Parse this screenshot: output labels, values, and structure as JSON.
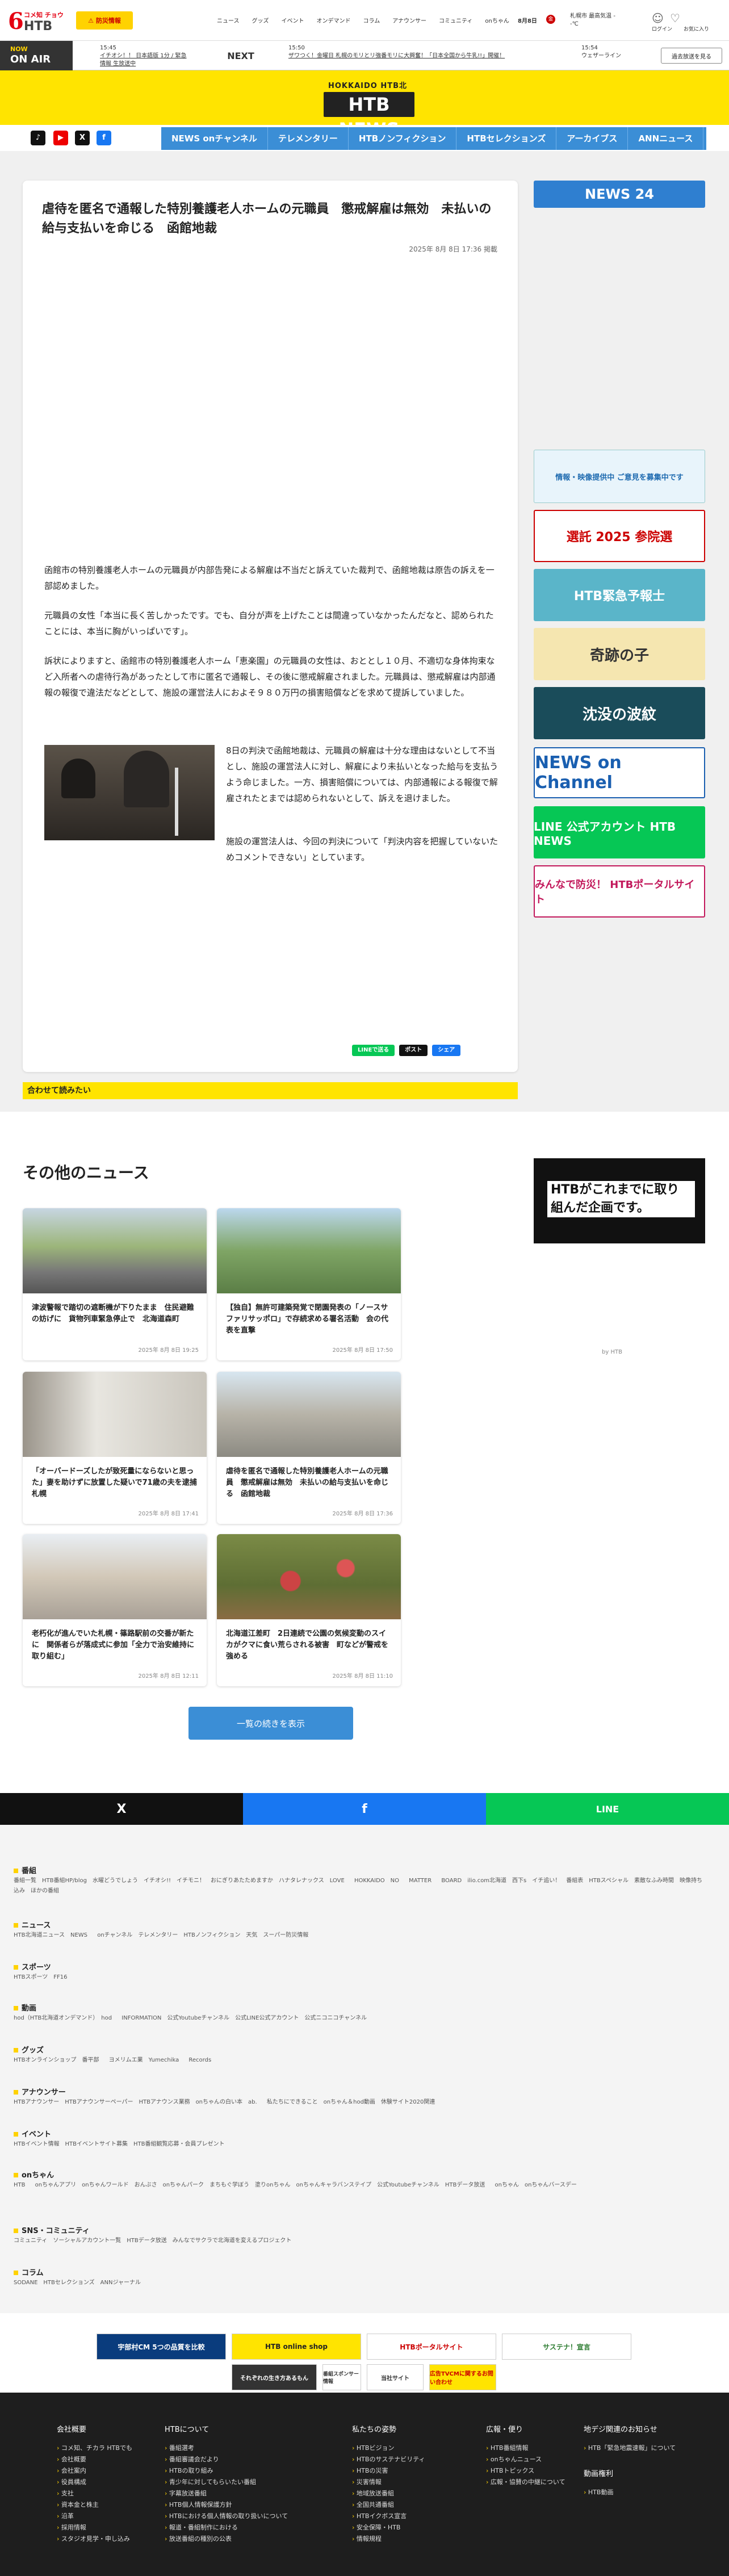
{
  "header": {
    "logo_small": "コメ知 チョウ",
    "logo_htb": "HTB",
    "disaster_button": "防災情報",
    "nav": [
      "ニュース",
      "グッズ",
      "イベント",
      "オンデマンド",
      "コラム",
      "アナウンサー",
      "コミュニティ",
      "onちゃん"
    ],
    "weather_date": "8月8日",
    "weather_badge": "金",
    "weather_place": "札幌市 最高気温 --℃",
    "account_links": [
      "ログイン",
      "お気に入り"
    ]
  },
  "onair": {
    "now_label": "NOW",
    "now_sub": "ON AIR",
    "now_time": "15:45",
    "now_title": "イチオシ！！ 日本語版 1分 / 緊急情報 生放送中",
    "next_label": "NEXT",
    "next_time": "15:50",
    "next_title": "ザワつく！金曜日 札幌のモリとリ強番モリに大興奮！「日本全国から牛乳!!」開催！",
    "later_time": "15:54",
    "later_title": "ウェザーライン",
    "past_button": "過去放送を見る"
  },
  "yellow_header": {
    "hokkaido": "HOKKAIDO HTB北海道ニュース",
    "news": "HTB NEWS"
  },
  "social_icons": [
    "tiktok-icon",
    "youtube-icon",
    "x-icon",
    "facebook-icon"
  ],
  "category_nav": [
    "NEWS onチャンネル",
    "テレメンタリー",
    "HTBノンフィクション",
    "HTBセレクションズ",
    "アーカイブス",
    "ANNニュース"
  ],
  "article": {
    "title": "虐待を匿名で通報した特別養護老人ホームの元職員　懲戒解雇は無効　未払いの給与支払いを命じる　函館地裁",
    "date": "2025年 8月 8日 17:36 掲載",
    "p1": "函館市の特別養護老人ホームの元職員が内部告発による解雇は不当だと訴えていた裁判で、函館地裁は原告の訴えを一部認めました。",
    "p2": "元職員の女性「本当に長く苦しかったです。でも、自分が声を上げたことは間違っていなかったんだなと、認められたことには、本当に胸がいっぱいです」。",
    "p3": "訴状によりますと、函館市の特別養護老人ホーム「恵楽園」の元職員の女性は、おととし１０月、不適切な身体拘束など入所者への虐待行為があったとして市に匿名で通報し、その後に懲戒解雇されました。元職員は、懲戒解雇は内部通報の報復で違法だなどとして、施設の運営法人におよそ９８０万円の損害賠償などを求めて提訴していました。",
    "p4": "8日の判決で函館地裁は、元職員の解雇は十分な理由はないとして不当とし、施設の運営法人に対し、解雇により未払いとなった給与を支払うよう命じました。一方、損害賠償については、内部通報による報復で解雇されたとまでは認められないとして、訴えを退けました。",
    "p5": "施設の運営法人は、今回の判決について「判決内容を把握していないためコメントできない」としています。",
    "share": [
      "LINEで送る",
      "ポスト",
      "シェア"
    ]
  },
  "related_title": "合わせて読みたい",
  "sidebar": {
    "banners": [
      "NEWS 24",
      "情報・映像提供中 ご意見を募集中です",
      "選託 2025 参院選",
      "HTB緊急予報士",
      "奇跡の子",
      "沈没の波紋",
      "NEWS on Channel",
      "LINE 公式アカウント HTB NEWS",
      "みんなで防災！ HTBポータルサイト"
    ]
  },
  "other_news": {
    "title": "その他のニュース",
    "cards": [
      {
        "text": "津波警報で踏切の遮断機が下りたまま　住民避難の妨げに　貨物列車緊急停止で　北海道森町",
        "date": "2025年 8月 8日 19:25"
      },
      {
        "text": "【独自】無許可建築発覚で閉園発表の「ノースサファリサッポロ」で存続求める署名活動　会の代表を直撃",
        "date": "2025年 8月 8日 17:50"
      },
      {
        "text": "「オーバードーズしたが致死量にならないと思った」妻を助けずに放置した疑いで71歳の夫を逮捕　札幌",
        "date": "2025年 8月 8日 17:41"
      },
      {
        "text": "虐待を匿名で通報した特別養護老人ホームの元職員　懲戒解雇は無効　未払いの給与支払いを命じる　函館地裁",
        "date": "2025年 8月 8日 17:36"
      },
      {
        "text": "老朽化が進んでいた札幌・篠路駅前の交番が新たに　関係者らが落成式に参加「全力で治安維持に取り組む」",
        "date": "2025年 8月 8日 12:11"
      },
      {
        "text": "北海道江差町　2日連続で公園の気候変動のスイカがクマに食い荒らされる被害　町などが警戒を強める",
        "date": "2025年 8月 8日 11:10"
      }
    ],
    "more_button": "一覧の続きを表示",
    "side_ad": "HTBがこれまでに取り組んだ企画です。",
    "side_caption": "by HTB"
  },
  "share_strip": [
    "X",
    "f",
    "LINE"
  ],
  "sitemap": [
    {
      "h": "番組",
      "l": "番組一覧　HTB番組HP/blog　水曜どうでしょう　イチオシ!!　イチモニ！　おにぎりあたためますか　ハナタレナックス　LOVE HOKKAIDO　NO MATTER BOARD　ilio.com北海道　西下s　イチ追い！　番組表　HTBスペシャル　素敵なふみ時間　映像持ち込み　ほかの番組"
    },
    {
      "h": "ニュース",
      "l": "HTB北海道ニュース　NEWS onチャンネル　テレメンタリー　HTBノンフィクション　天気　スーパー防災情報"
    },
    {
      "h": "スポーツ",
      "l": "HTBスポーツ　FF16"
    },
    {
      "h": "動画",
      "l": "hod（HTB北海道オンデマンド）　hod INFORMATION　公式Youtubeチャンネル　公式LINE公式アカウント　公式ニコニコチャンネル"
    },
    {
      "h": "グッズ",
      "l": "HTBオンラインショップ　番平部 ヨメリムエ業　Yumechika Records"
    },
    {
      "h": "アナウンサー",
      "l": "HTBアナウンサー　HTBアナウンサーペーパー　HTBアナウンス業務　onちゃんの白い本　ab. 私たちにできること　onちゃん＆hod動画　休験サイト2020関連"
    },
    {
      "h": "イベント",
      "l": "HTBイベント情報　HTBイベントサイト募集　HTB番組観覧応募・会員プレゼント"
    },
    {
      "h": "onちゃん",
      "l": "HTB onちゃんアプリ　onちゃんワールド　おんぶさ　onちゃんパーク　まちもぐ学ぼう　塗りonちゃん　onちゃんキャラバンステイプ　公式Youtubeチャンネル　HTBデータ放送 onちゃん　onちゃんバースデー"
    },
    {
      "h": "SNS・コミュニティ",
      "l": "コミュニティ　ソーシャルアカウント一覧　HTBデータ放送　みんなでサクラで北海道を変えるプロジェクト"
    },
    {
      "h": "コラム",
      "l": "SODANE　HTBセレクションズ　ANNジャーナル"
    }
  ],
  "bottom_banners": [
    "宇部村CM 5つの品質を比較",
    "HTB online shop",
    "HTBポータルサイト",
    "サステナ！宣言",
    "それぞれの生き方あるもん",
    "番組スポンサー情報",
    "当社サイト",
    "広告TVCMに関するお問い合わせ"
  ],
  "footer": {
    "cols": [
      {
        "h": "会社概要",
        "items": [
          "コメ知、チカラ HTBでも",
          "会社概要",
          "会社案内",
          "役員構成",
          "支社",
          "資本金と株主",
          "沿革",
          "採用情報",
          "スタジオ見学・申し込み"
        ]
      },
      {
        "h": "HTBについて",
        "items": [
          "番組選考",
          "番組審議会だより",
          "HTBの取り組み",
          "青少年に対してもらいたい番組",
          "字幕放送番組",
          "HTB個人情報保護方針",
          "HTBにおける個人情報の取り扱いについて",
          "報道・番組制作における",
          "放送番組の種別の公表"
        ]
      },
      {
        "h": "私たちの姿勢",
        "items": [
          "HTBビジョン",
          "HTBのサステナビリティ",
          "HTBの災害",
          "災害情報",
          "地域放送番組",
          "全国共通番組",
          "HTBイクボス宣言",
          "安全保障・HTB",
          "情報規程"
        ]
      },
      {
        "h": "広報・便り",
        "items": [
          "HTB番組情報",
          "onちゃんニュース",
          "HTBトピックス",
          "広報・協賛の中継について"
        ]
      },
      {
        "h": "地デジ関連のお知らせ",
        "items": [
          "HTB「緊急地震速報」について"
        ]
      }
    ],
    "col5_h2": "動画権利",
    "col5_items2": [
      "HTB動画"
    ]
  },
  "colors": {
    "yellow": "#ffe400",
    "blue": "#3b8ed6",
    "red": "#e40012",
    "dark": "#1e1e1e"
  }
}
